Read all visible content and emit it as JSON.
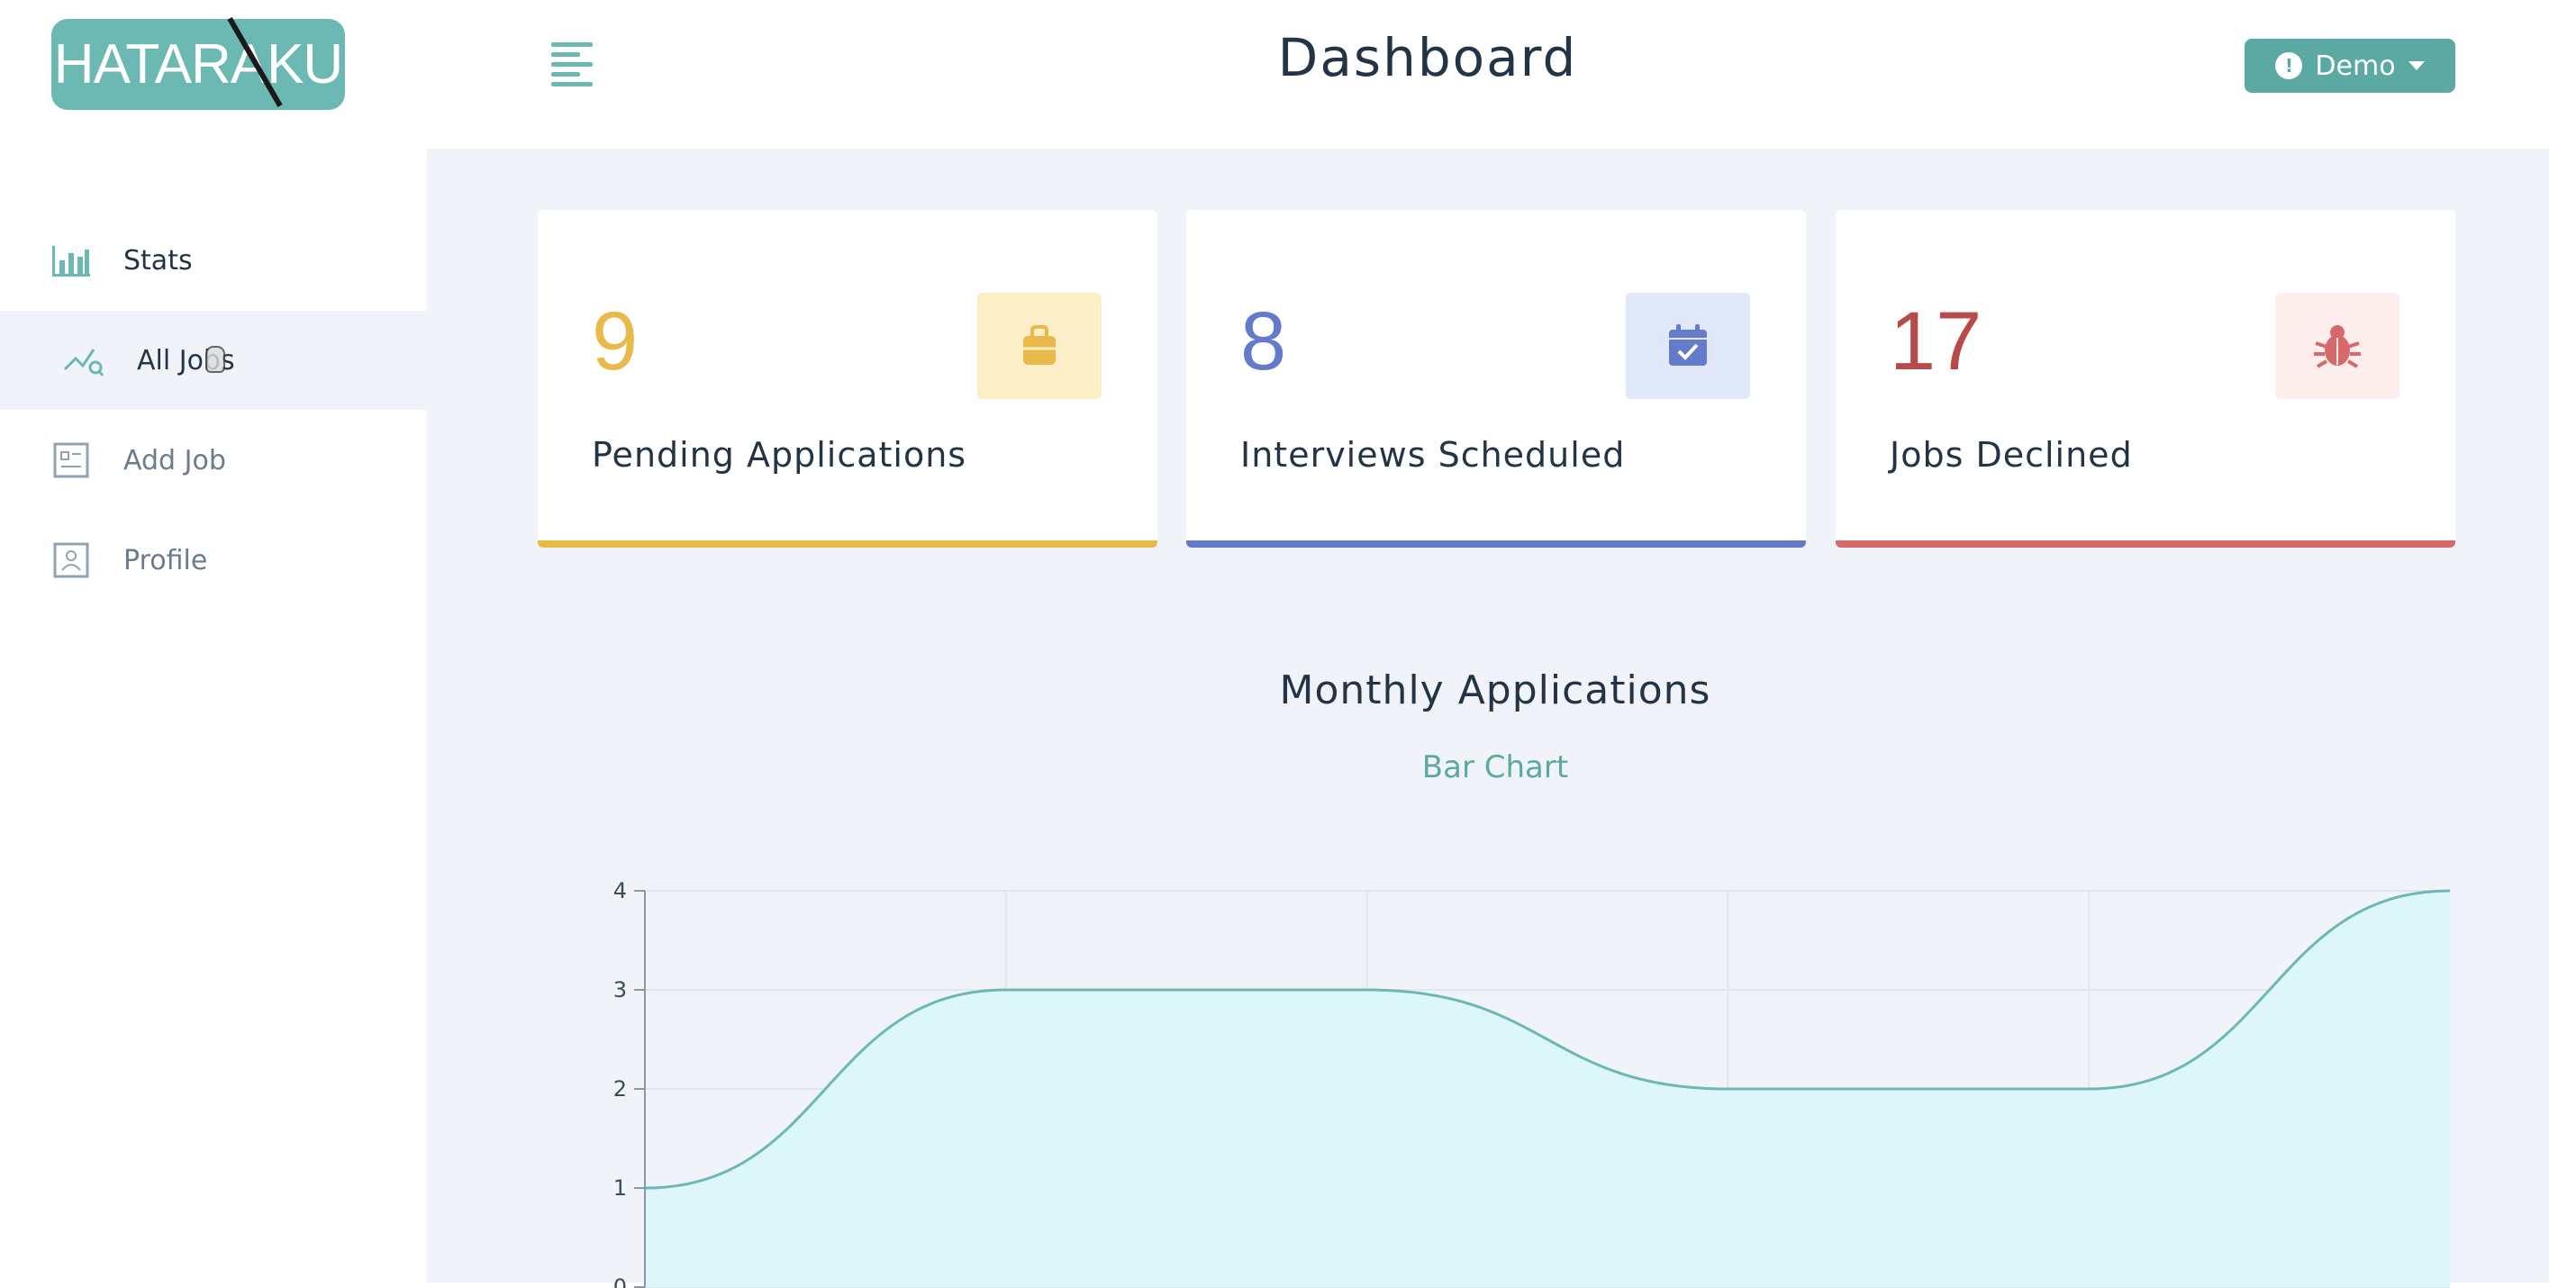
{
  "brand": {
    "logo_text": "HATARAKU"
  },
  "header": {
    "title": "Dashboard",
    "user_label": "Demo"
  },
  "sidebar": {
    "items": [
      {
        "label": "Stats",
        "icon": "bar-chart-icon"
      },
      {
        "label": "All Jobs",
        "icon": "query-stats-icon"
      },
      {
        "label": "Add Job",
        "icon": "form-icon"
      },
      {
        "label": "Profile",
        "icon": "id-card-icon"
      }
    ]
  },
  "stats": [
    {
      "count": "9",
      "label": "Pending Applications",
      "icon": "suitcase-icon",
      "color": "#e9b949",
      "bg": "#fcefc7"
    },
    {
      "count": "8",
      "label": "Interviews Scheduled",
      "icon": "calendar-check-icon",
      "color": "#647acb",
      "bg": "#e0e8f9"
    },
    {
      "count": "17",
      "label": "Jobs Declined",
      "icon": "bug-icon",
      "color": "#d66a6a",
      "bg": "#ffeeee"
    }
  ],
  "chart": {
    "title": "Monthly Applications",
    "toggle_label": "Bar Chart"
  },
  "chart_data": {
    "type": "area",
    "title": "",
    "xlabel": "",
    "ylabel": "",
    "y": [
      1,
      3,
      3,
      2,
      2,
      4
    ],
    "ylim": [
      0,
      4
    ],
    "yticks": [
      "0",
      "1",
      "2",
      "3",
      "4"
    ],
    "grid": true,
    "stroke_color": "#6cb8b2",
    "fill_color": "#dcf6fa"
  }
}
